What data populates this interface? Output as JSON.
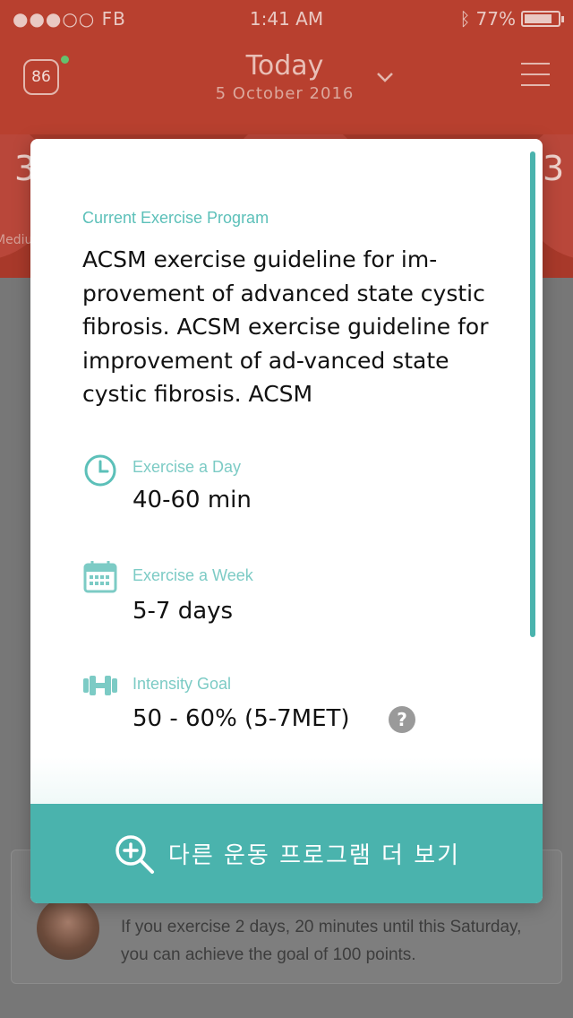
{
  "status_bar": {
    "carrier": "●●●○○ FB",
    "time": "1:41 AM",
    "battery": "77%"
  },
  "header": {
    "score": "86",
    "title": "Today",
    "date": "5 October 2016"
  },
  "metrics": {
    "left_number": "3",
    "left_label": "Mediu",
    "right_number": "3"
  },
  "modal": {
    "section_label": "Current Exercise Program",
    "program_description": "ACSM exercise guideline for im-provement of advanced state cystic fibrosis. ACSM exercise guideline for improvement of ad-vanced state cystic fibrosis. ACSM",
    "stats": [
      {
        "icon": "clock-icon",
        "label": "Exercise a Day",
        "value": "40-60 min"
      },
      {
        "icon": "calendar-icon",
        "label": "Exercise a Week",
        "value": "5-7 days"
      },
      {
        "icon": "dumbbell-icon",
        "label": "Intensity Goal",
        "value": "50 - 60% (5-7MET)"
      }
    ],
    "help_label": "?",
    "more_button_label": "다른 운동 프로그램 더 보기"
  },
  "notice": {
    "text": "If you exercise 2 days, 20 minutes until this Saturday, you can achieve the goal of 100 points."
  },
  "colors": {
    "teal": "#4ab3ad",
    "header_red": "#b8402f",
    "label_teal": "#5cc0b9"
  }
}
